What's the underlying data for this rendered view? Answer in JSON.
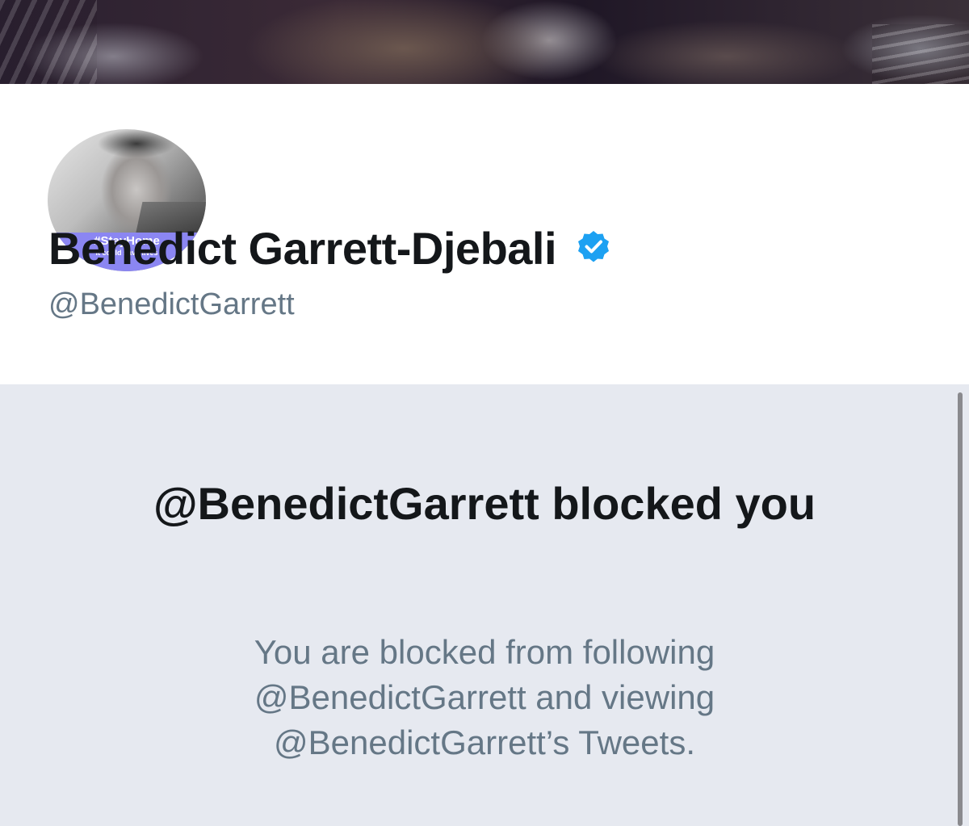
{
  "profile": {
    "avatar_tag": "#StayHome",
    "avatar_subtext": "It could save lives",
    "display_name": "Benedict Garrett-Djebali",
    "verified": true,
    "handle": "@BenedictGarrett"
  },
  "blocked": {
    "title": "@BenedictGarrett blocked you",
    "description": "You are blocked from following @BenedictGarrett and viewing @BenedictGarrett’s Tweets."
  },
  "colors": {
    "verified_badge": "#1da1f2",
    "handle_text": "#657786",
    "panel_bg": "#e6e9f0",
    "avatar_banner": "#8b86f2"
  },
  "icons": {
    "verified": "verified-badge-icon"
  }
}
